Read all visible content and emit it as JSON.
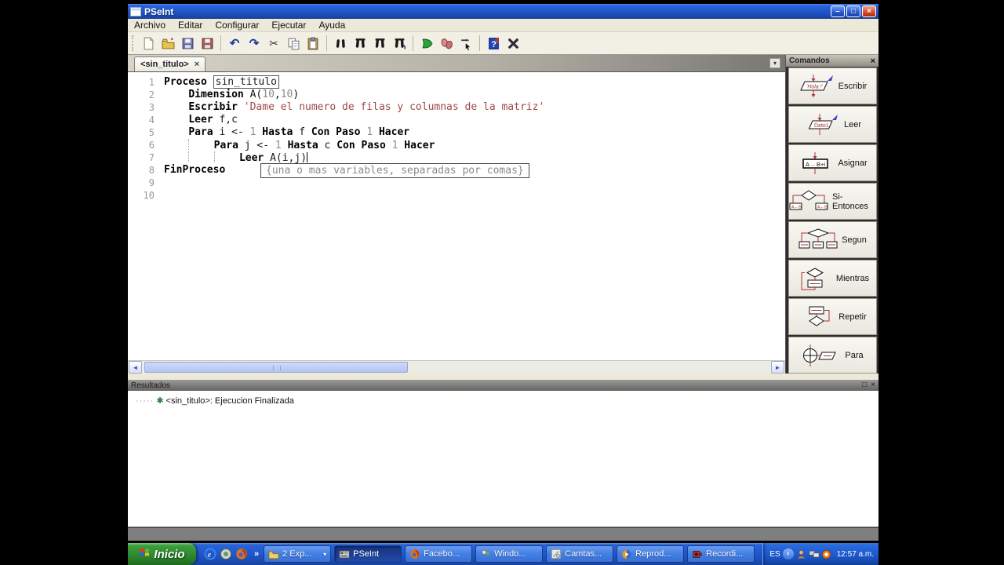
{
  "window": {
    "title": "PSeInt"
  },
  "menu": [
    "Archivo",
    "Editar",
    "Configurar",
    "Ejecutar",
    "Ayuda"
  ],
  "toolbar": [
    "new",
    "open",
    "save",
    "save-all",
    "|",
    "undo",
    "redo",
    "cut",
    "copy",
    "paste",
    "|",
    "find",
    "find-next",
    "replace",
    "replace-special",
    "|",
    "run",
    "run-step-by-step",
    "execute-step",
    "|",
    "help",
    "close-file"
  ],
  "tab": {
    "label": "<sin_titulo>"
  },
  "editor": {
    "tooltip": "{una o mas variables, separadas por comas}",
    "lines": [
      {
        "n": "1",
        "seg": [
          {
            "c": "k",
            "t": "Proceso "
          },
          {
            "c": "box",
            "t": "sin_titulo"
          }
        ]
      },
      {
        "n": "2",
        "seg": [
          {
            "c": "p",
            "t": "    "
          },
          {
            "c": "k",
            "t": "Dimension "
          },
          {
            "c": "p",
            "t": "A("
          },
          {
            "c": "n",
            "t": "10"
          },
          {
            "c": "p",
            "t": ","
          },
          {
            "c": "n",
            "t": "10"
          },
          {
            "c": "p",
            "t": ")"
          }
        ]
      },
      {
        "n": "3",
        "seg": [
          {
            "c": "p",
            "t": "    "
          },
          {
            "c": "k",
            "t": "Escribir "
          },
          {
            "c": "s",
            "t": "'Dame el numero de filas y columnas de la matriz'"
          }
        ]
      },
      {
        "n": "4",
        "seg": [
          {
            "c": "p",
            "t": "    "
          },
          {
            "c": "k",
            "t": "Leer "
          },
          {
            "c": "p",
            "t": "f,c"
          }
        ]
      },
      {
        "n": "5",
        "seg": [
          {
            "c": "p",
            "t": "    "
          },
          {
            "c": "k",
            "t": "Para "
          },
          {
            "c": "p",
            "t": "i <- "
          },
          {
            "c": "n",
            "t": "1"
          },
          {
            "c": "p",
            "t": " "
          },
          {
            "c": "k",
            "t": "Hasta "
          },
          {
            "c": "p",
            "t": "f "
          },
          {
            "c": "k",
            "t": "Con Paso "
          },
          {
            "c": "n",
            "t": "1"
          },
          {
            "c": "p",
            "t": " "
          },
          {
            "c": "k",
            "t": "Hacer"
          }
        ]
      },
      {
        "n": "6",
        "seg": [
          {
            "c": "p",
            "t": "    "
          },
          {
            "c": "g",
            "t": ""
          },
          {
            "c": "p",
            "t": "    "
          },
          {
            "c": "k",
            "t": "Para "
          },
          {
            "c": "p",
            "t": "j <- "
          },
          {
            "c": "n",
            "t": "1"
          },
          {
            "c": "p",
            "t": " "
          },
          {
            "c": "k",
            "t": "Hasta "
          },
          {
            "c": "p",
            "t": "c "
          },
          {
            "c": "k",
            "t": "Con Paso "
          },
          {
            "c": "n",
            "t": "1"
          },
          {
            "c": "p",
            "t": " "
          },
          {
            "c": "k",
            "t": "Hacer"
          }
        ]
      },
      {
        "n": "7",
        "seg": [
          {
            "c": "p",
            "t": "    "
          },
          {
            "c": "g",
            "t": ""
          },
          {
            "c": "p",
            "t": "    "
          },
          {
            "c": "g",
            "t": ""
          },
          {
            "c": "p",
            "t": "    "
          },
          {
            "c": "k",
            "t": "Leer "
          },
          {
            "c": "p",
            "t": "A(i,j)"
          },
          {
            "c": "caret",
            "t": ""
          }
        ]
      },
      {
        "n": "8",
        "seg": [
          {
            "c": "k",
            "t": "FinProceso"
          }
        ]
      },
      {
        "n": "9",
        "seg": []
      },
      {
        "n": "10",
        "seg": []
      }
    ]
  },
  "comandos": {
    "title": "Comandos",
    "buttons": [
      {
        "label": "Escribir",
        "icon": "escribir-flowchart-icon",
        "icon_text": "'Hola !'"
      },
      {
        "label": "Leer",
        "icon": "leer-flowchart-icon",
        "icon_text": "Dato1"
      },
      {
        "label": "Asignar",
        "icon": "asignar-flowchart-icon",
        "icon_text": "A←B+i"
      },
      {
        "label": "Si-Entonces",
        "icon": "si-entonces-flowchart-icon",
        "icon_text": ""
      },
      {
        "label": "Segun",
        "icon": "segun-flowchart-icon",
        "icon_text": ""
      },
      {
        "label": "Mientras",
        "icon": "mientras-flowchart-icon",
        "icon_text": ""
      },
      {
        "label": "Repetir",
        "icon": "repetir-flowchart-icon",
        "icon_text": ""
      },
      {
        "label": "Para",
        "icon": "para-flowchart-icon",
        "icon_text": ""
      }
    ]
  },
  "resultados": {
    "title": "Resultados",
    "item_text": "<sin_titulo>: Ejecucion Finalizada"
  },
  "taskbar": {
    "start_label": "Inicio",
    "quicklaunch": [
      "internet-explorer-icon",
      "windows-app-icon",
      "firefox-icon"
    ],
    "buttons": [
      {
        "label": "2 Exp...",
        "icon": "folder-icon",
        "dropdown": true,
        "pressed": false
      },
      {
        "label": "PSeInt",
        "icon": "pseint-app-icon",
        "dropdown": false,
        "pressed": true
      },
      {
        "label": "Facebo...",
        "icon": "firefox-icon",
        "dropdown": false,
        "pressed": false
      },
      {
        "label": "Windo...",
        "icon": "messenger-icon",
        "dropdown": false,
        "pressed": false
      },
      {
        "label": "Camtas...",
        "icon": "camtasia-icon",
        "dropdown": false,
        "pressed": false
      },
      {
        "label": "Reprod...",
        "icon": "media-player-icon",
        "dropdown": false,
        "pressed": false
      },
      {
        "label": "Recordi...",
        "icon": "recorder-icon",
        "dropdown": false,
        "pressed": false
      }
    ],
    "tray": {
      "lang": "ES",
      "icons": [
        "messenger-tray-icon",
        "network-tray-icon",
        "camtasia-tray-icon"
      ],
      "time": "12:57 a.m."
    }
  },
  "glyphs": {
    "minimize": "–",
    "restore": "□",
    "close": "×",
    "tab_close": "×",
    "tab_dropdown": "▾",
    "panel_close": "×",
    "panel_float": "□",
    "tree_dots": "·····",
    "tree_star": "✱",
    "scroll_left": "◄",
    "scroll_right": "►",
    "overflow_chevron": "»",
    "tray_chevron": "‹",
    "task_dropdown": "▾"
  }
}
